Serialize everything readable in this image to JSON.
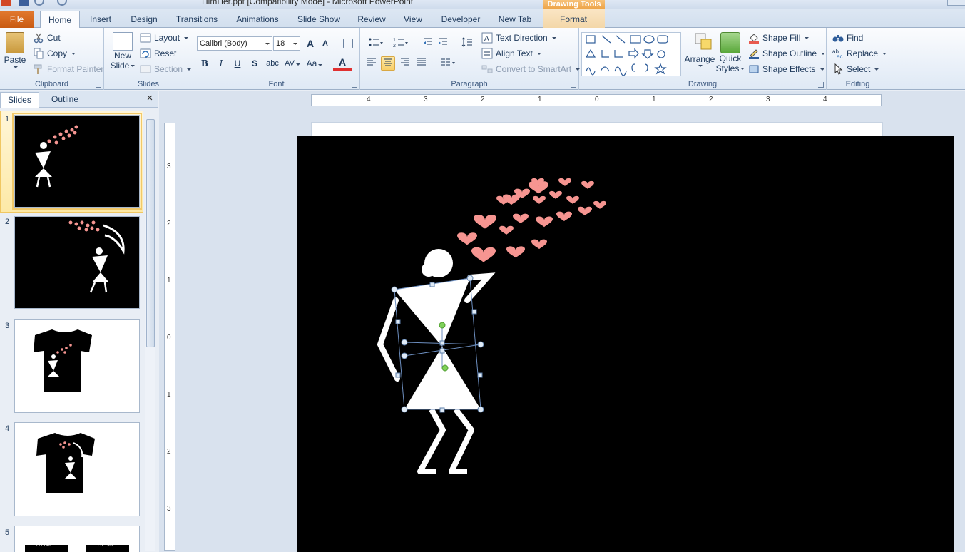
{
  "window": {
    "title": "HimHer.ppt [Compatibility Mode] - Microsoft PowerPoint",
    "context_tool_title": "Drawing Tools"
  },
  "tabs": {
    "file": "File",
    "home": "Home",
    "insert": "Insert",
    "design": "Design",
    "transitions": "Transitions",
    "animations": "Animations",
    "slide_show": "Slide Show",
    "review": "Review",
    "view": "View",
    "developer": "Developer",
    "new_tab": "New Tab",
    "format": "Format"
  },
  "clipboard": {
    "paste": "Paste",
    "cut": "Cut",
    "copy": "Copy",
    "format_painter": "Format Painter",
    "label": "Clipboard"
  },
  "slides_group": {
    "new_slide_line1": "New",
    "new_slide_line2": "Slide",
    "layout": "Layout",
    "reset": "Reset",
    "section": "Section",
    "label": "Slides"
  },
  "font": {
    "family": "Calibri (Body)",
    "size": "18",
    "bold": "B",
    "italic": "I",
    "underline": "U",
    "shadow": "S",
    "strike": "abc",
    "spacing": "AV",
    "case": "Aa",
    "grow": "A",
    "shrink": "A",
    "color": "A",
    "label": "Font"
  },
  "paragraph": {
    "text_direction": "Text Direction",
    "align_text": "Align Text",
    "convert_smartart": "Convert to SmartArt",
    "label": "Paragraph"
  },
  "drawing": {
    "arrange": "Arrange",
    "quick_styles_line1": "Quick",
    "quick_styles_line2": "Styles",
    "shape_fill": "Shape Fill",
    "shape_outline": "Shape Outline",
    "shape_effects": "Shape Effects",
    "label": "Drawing"
  },
  "editing": {
    "find": "Find",
    "replace": "Replace",
    "select": "Select",
    "label": "Editing"
  },
  "panel": {
    "tab_slides": "Slides",
    "tab_outline": "Outline",
    "close": "×",
    "numbers": [
      "1",
      "2",
      "3",
      "4",
      "5"
    ]
  },
  "ruler": {
    "horizontal": [
      "4",
      "3",
      "2",
      "1",
      "0",
      "1",
      "2",
      "3",
      "4"
    ],
    "vertical": [
      "3",
      "2",
      "1",
      "0",
      "1",
      "2",
      "3"
    ]
  },
  "thumb5": {
    "left": "For Her",
    "right": "For Him"
  },
  "colors": {
    "heart": "#f69591",
    "ribbon_accent": "#f9cf68",
    "file_tab": "#d8661c",
    "selection_handle": "#6c8ebf",
    "rotate_handle": "#7fd15a"
  }
}
